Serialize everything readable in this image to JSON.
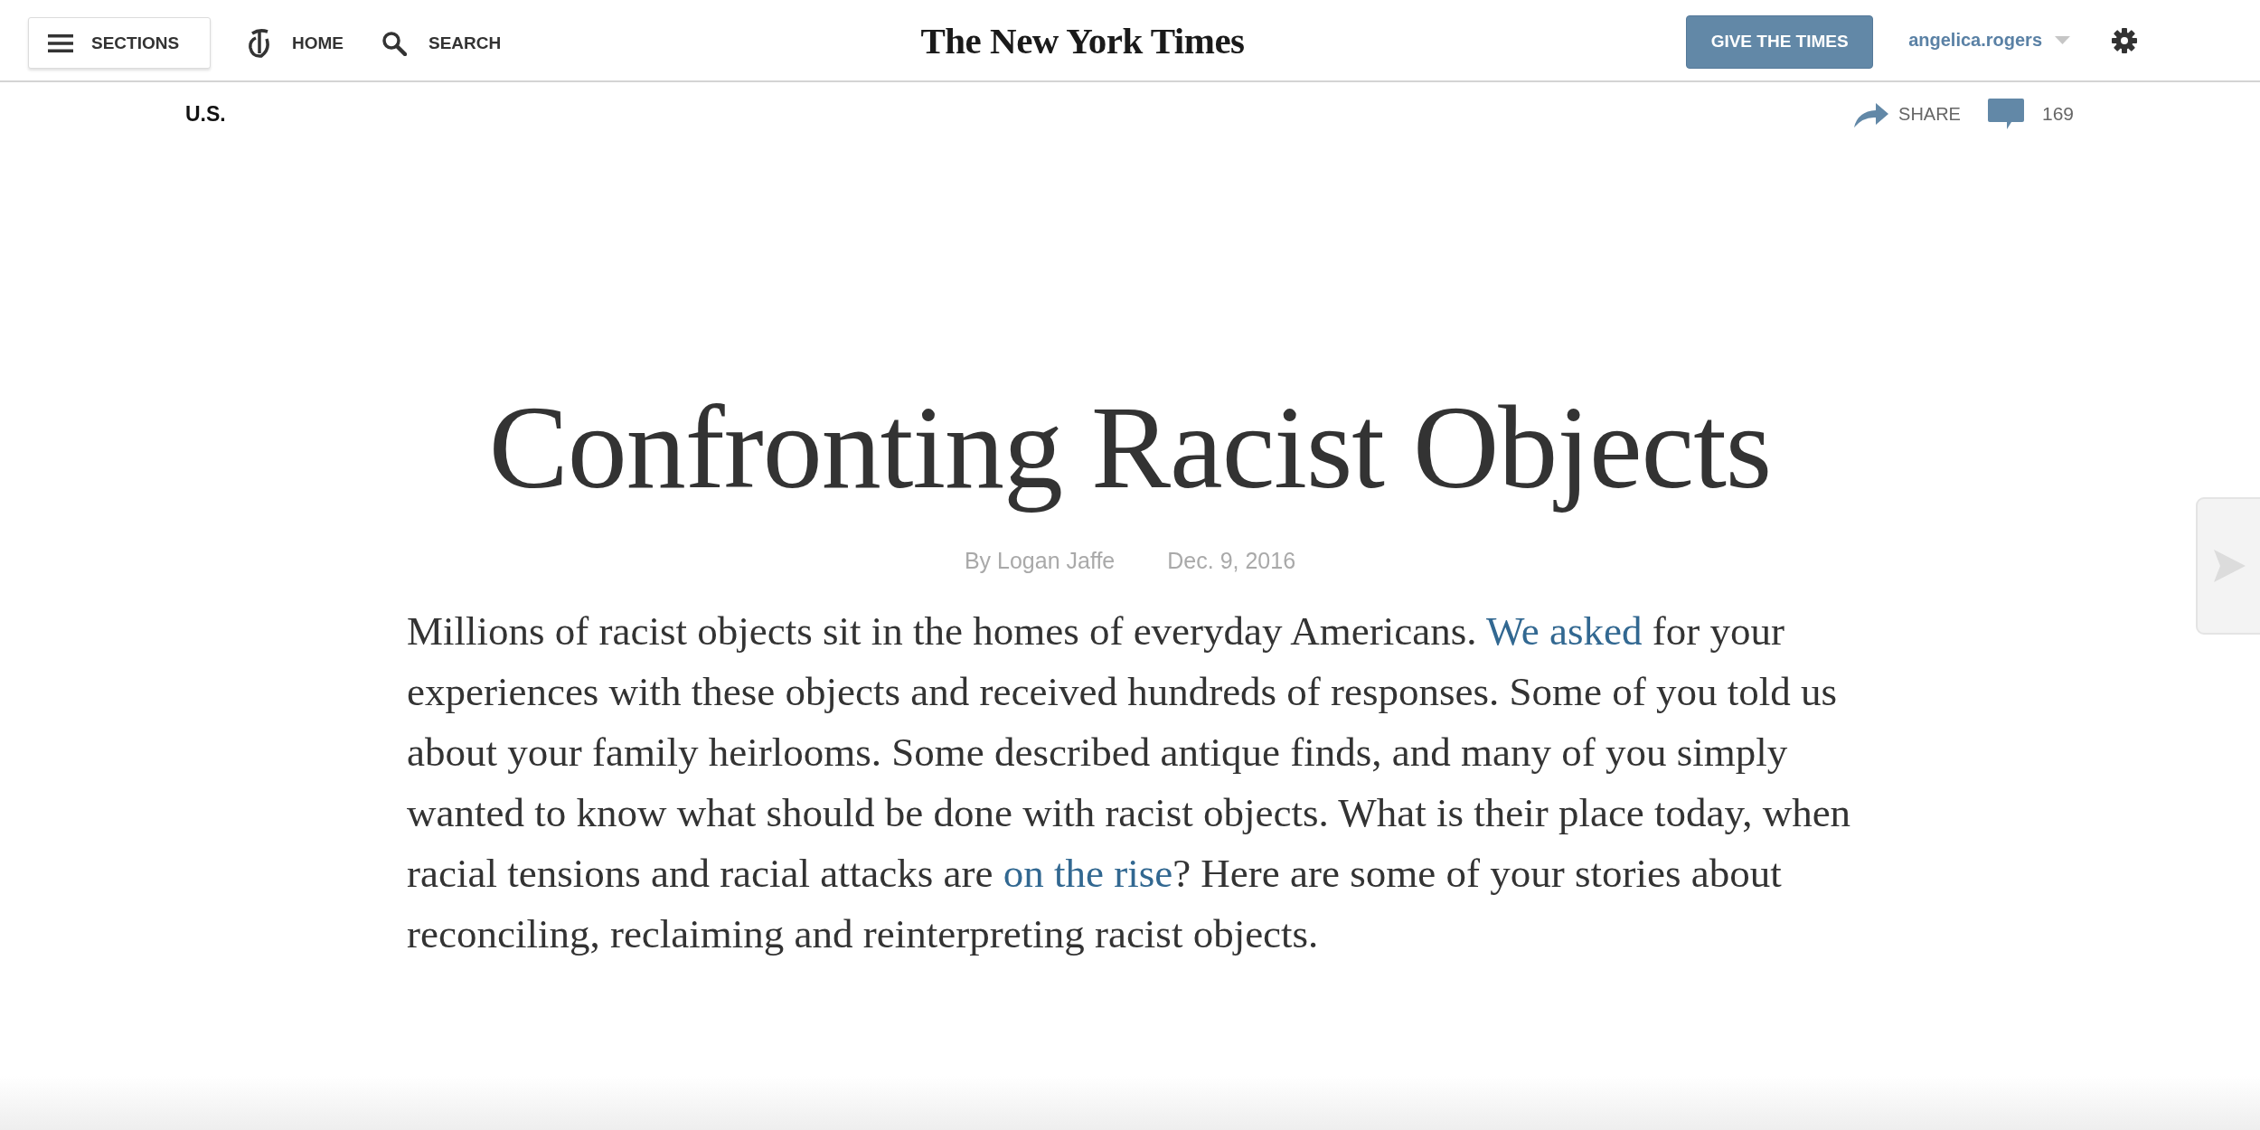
{
  "header": {
    "sections_button": {
      "label": "SECTIONS"
    },
    "home_link": {
      "label": "HOME"
    },
    "search_link": {
      "label": "SEARCH"
    },
    "logo": "The New York Times",
    "subscribe_button": {
      "label": "GIVE THE TIMES"
    },
    "user_menu": {
      "username": "angelica.rogers"
    }
  },
  "section_bar": {
    "section": "U.S.",
    "share": {
      "label": "SHARE"
    },
    "comments": {
      "count": "169"
    }
  },
  "article": {
    "headline": "Confronting Racist Objects",
    "byline": "By Logan Jaffe",
    "date": "Dec. 9, 2016",
    "intro": [
      {
        "kind": "text",
        "text": "Millions of racist objects sit in the homes of everyday Americans. "
      },
      {
        "kind": "link",
        "text": "We asked"
      },
      {
        "kind": "text",
        "text": " for your experiences with these objects and received hundreds of responses. Some of you told us about your family heirlooms. Some described antique finds, and many of you simply wanted to know what should be done with racist objects. What is their place today, when racial tensions and racial attacks are "
      },
      {
        "kind": "link",
        "text": "on the rise"
      },
      {
        "kind": "text",
        "text": "? Here are some of your stories about reconciling, reclaiming and reinterpreting racist objects."
      }
    ]
  }
}
